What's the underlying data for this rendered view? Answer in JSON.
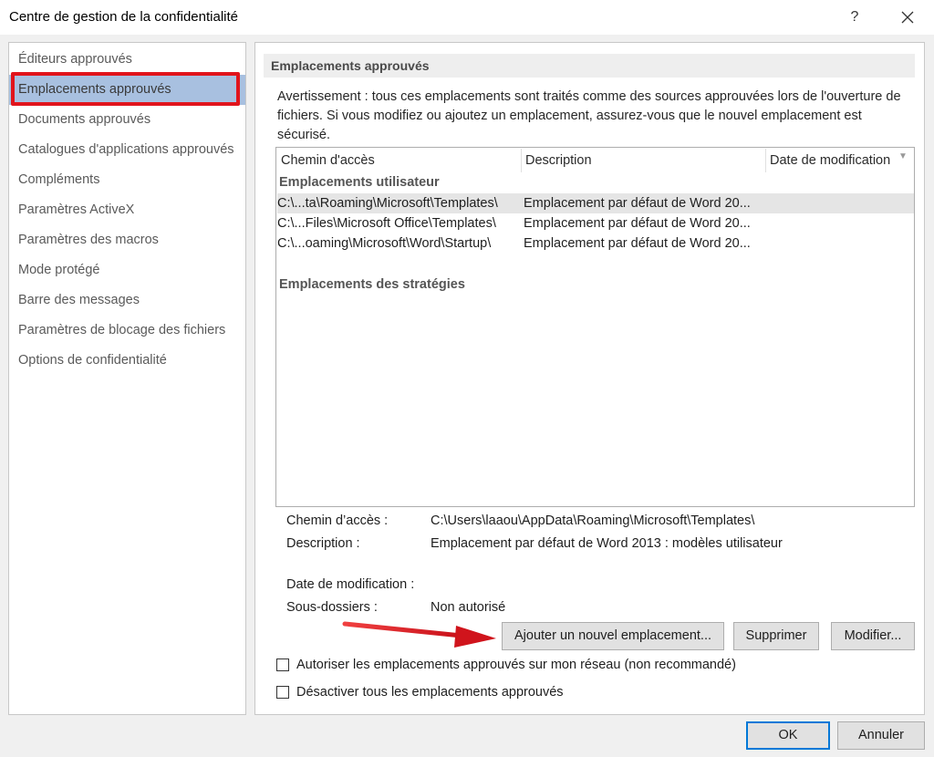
{
  "window": {
    "title": "Centre de gestion de la confidentialité",
    "help_label": "?",
    "close_label": "✕"
  },
  "sidebar": {
    "items": [
      {
        "label": "Éditeurs approuvés"
      },
      {
        "label": "Emplacements approuvés",
        "selected": true
      },
      {
        "label": "Documents approuvés"
      },
      {
        "label": "Catalogues d'applications approuvés"
      },
      {
        "label": "Compléments"
      },
      {
        "label": "Paramètres ActiveX"
      },
      {
        "label": "Paramètres des macros"
      },
      {
        "label": "Mode protégé"
      },
      {
        "label": "Barre des messages"
      },
      {
        "label": "Paramètres de blocage des fichiers"
      },
      {
        "label": "Options de confidentialité"
      }
    ]
  },
  "main": {
    "section_title": "Emplacements approuvés",
    "warning": "Avertissement : tous ces emplacements sont traités comme des sources approuvées lors de l'ouverture de fichiers. Si vous modifiez ou ajoutez un emplacement, assurez-vous que le nouvel emplacement est sécurisé.",
    "table": {
      "columns": [
        "Chemin d'accès",
        "Description",
        "Date de modification"
      ],
      "group_user": "Emplacements utilisateur",
      "rows": [
        {
          "path": "C:\\...ta\\Roaming\\Microsoft\\Templates\\",
          "description": "Emplacement par défaut de Word 20..."
        },
        {
          "path": "C:\\...Files\\Microsoft Office\\Templates\\",
          "description": "Emplacement par défaut de Word 20..."
        },
        {
          "path": "C:\\...oaming\\Microsoft\\Word\\Startup\\",
          "description": "Emplacement par défaut de Word 20..."
        }
      ],
      "group_policy": "Emplacements des stratégies"
    },
    "details": {
      "path_label": "Chemin d’accès :",
      "path_value": "C:\\Users\\laaou\\AppData\\Roaming\\Microsoft\\Templates\\",
      "description_label": "Description :",
      "description_value": "Emplacement par défaut de Word 2013 : modèles utilisateur",
      "date_label": "Date de modification :",
      "date_value": "",
      "subfolders_label": "Sous-dossiers :",
      "subfolders_value": "Non autorisé"
    },
    "buttons": {
      "add": "Ajouter un nouvel emplacement...",
      "remove": "Supprimer",
      "modify": "Modifier..."
    },
    "checkboxes": {
      "allow_network": "Autoriser les emplacements approuvés sur mon réseau (non recommandé)",
      "disable_all": "Désactiver tous les emplacements approuvés"
    }
  },
  "footer": {
    "ok": "OK",
    "cancel": "Annuler"
  },
  "colors": {
    "selection": "#a8c0e0",
    "annotation_red": "#e1141c",
    "default_button_border": "#0078d7"
  }
}
